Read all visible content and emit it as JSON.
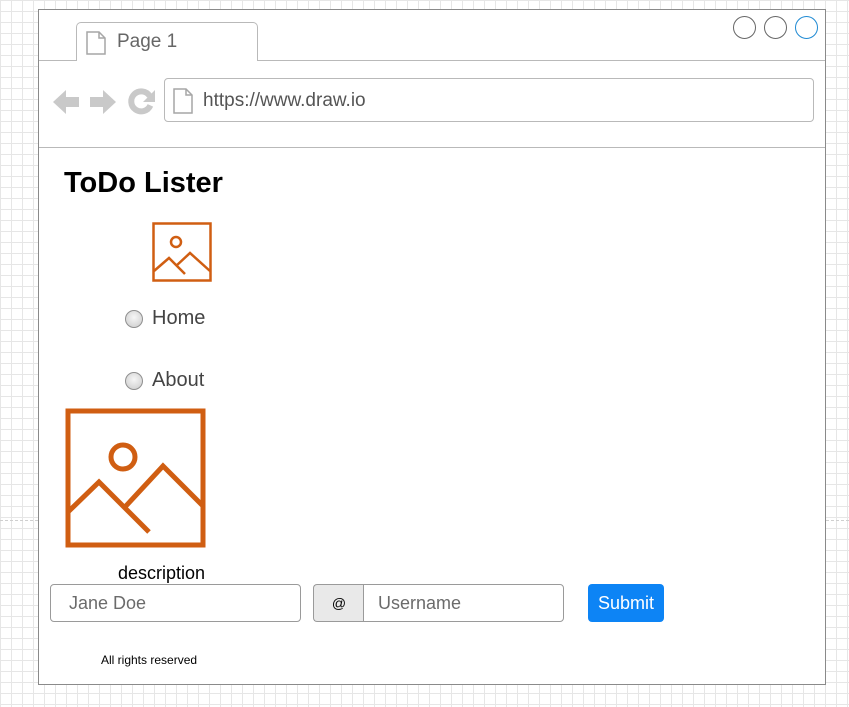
{
  "browser": {
    "tab": {
      "label": "Page 1"
    },
    "address_bar": {
      "url": "https://www.draw.io"
    }
  },
  "page": {
    "title": "ToDo Lister",
    "nav": [
      {
        "label": "Home"
      },
      {
        "label": "About"
      }
    ],
    "image_caption": "description",
    "form": {
      "name_placeholder": "Jane Doe",
      "addon_label": "@",
      "username_placeholder": "Username",
      "submit_label": "Submit"
    },
    "footer": "All rights reserved"
  },
  "colors": {
    "accent": "#0d84f5",
    "image_placeholder": "#d05e12",
    "nav_icons": "#c9c9c9",
    "window_control_active": "#1f8ad3"
  }
}
